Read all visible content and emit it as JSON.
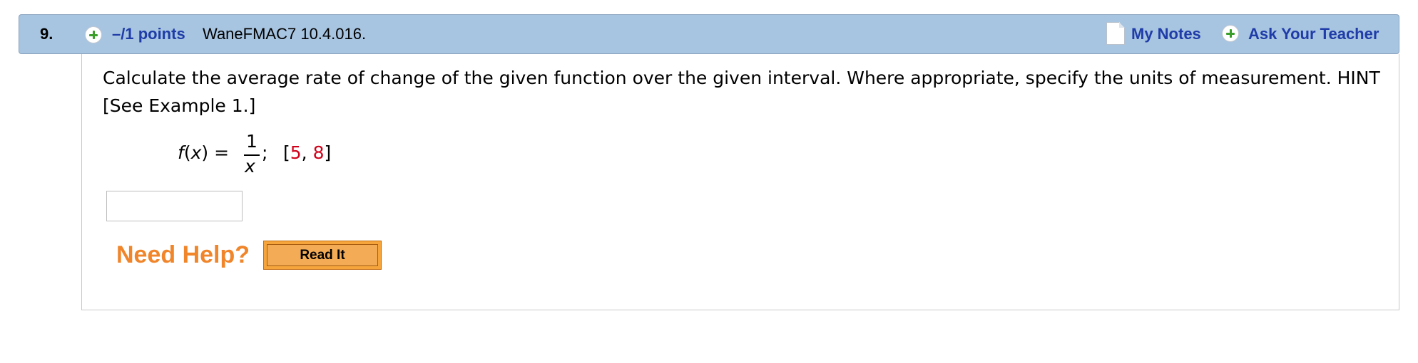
{
  "question": {
    "number": "9.",
    "points": "–/1 points",
    "source": "WaneFMAC7 10.4.016.",
    "my_notes_label": "My Notes",
    "ask_teacher_label": "Ask Your Teacher"
  },
  "prompt": "Calculate the average rate of change of the given function over the given interval. Where appropriate, specify the units of measurement. HINT [See Example 1.]",
  "formula": {
    "func_name": "f",
    "open_paren": "(",
    "var": "x",
    "close_eq": ") = ",
    "numerator": "1",
    "denominator": "x",
    "separator": ";",
    "interval_open": "[",
    "interval_start": "5",
    "interval_comma": ", ",
    "interval_end": "8",
    "interval_close": "]"
  },
  "answer": {
    "value": ""
  },
  "help": {
    "label": "Need Help?",
    "read_it_label": "Read It"
  },
  "colors": {
    "header_bg": "#a7c4e0",
    "link": "#1f3ca8",
    "help_orange": "#f0852a",
    "interval_red": "#d0021b"
  },
  "icons": {
    "points": "plus-circle-icon",
    "notes": "note-page-icon",
    "teacher": "plus-circle-icon"
  }
}
